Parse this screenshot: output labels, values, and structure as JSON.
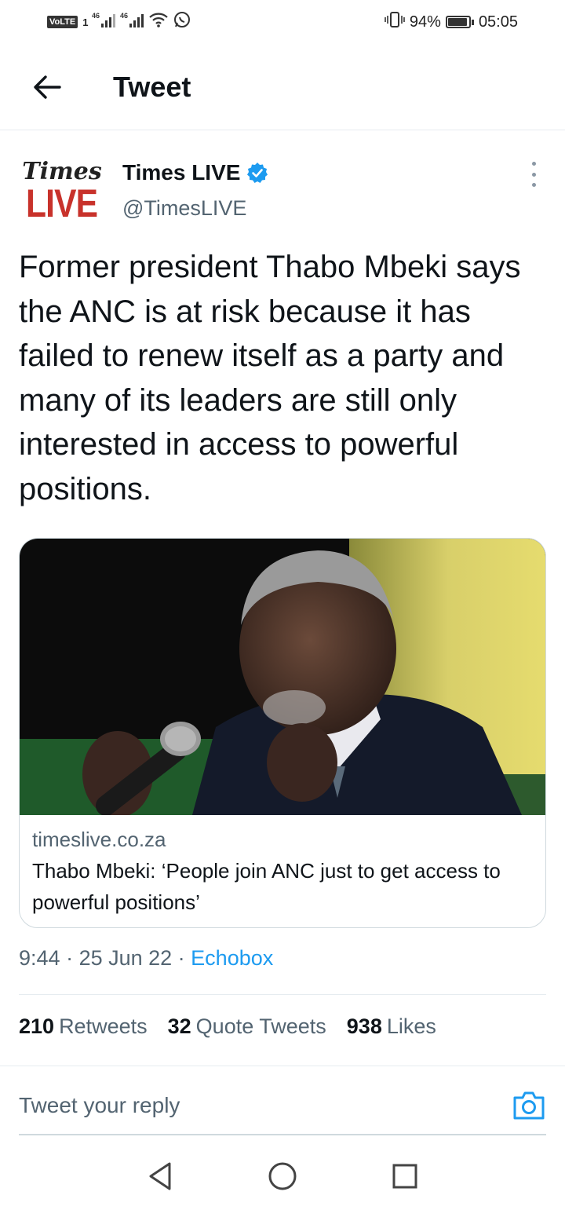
{
  "status_bar": {
    "volte": "VoLTE",
    "sim1": "1",
    "net1": "46",
    "net2": "46",
    "battery": "94%",
    "time": "05:05"
  },
  "header": {
    "title": "Tweet"
  },
  "author": {
    "logo_top": "Times",
    "logo_bottom": "LIVE",
    "name": "Times LIVE",
    "handle": "@TimesLIVE",
    "verified": true
  },
  "tweet": {
    "text": "Former president Thabo Mbeki says the ANC is at risk because it has failed to renew itself as a party and many of its leaders are still only interested in access to powerful positions."
  },
  "card": {
    "domain": "timeslive.co.za",
    "title": "Thabo Mbeki: ‘People join ANC just to get access to powerful positions’"
  },
  "meta": {
    "time": "9:44",
    "sep1": " · ",
    "date": "25 Jun 22",
    "sep2": " · ",
    "source": "Echobox"
  },
  "stats": {
    "retweets_count": "210",
    "retweets_label": "Retweets",
    "quotes_count": "32",
    "quotes_label": "Quote Tweets",
    "likes_count": "938",
    "likes_label": "Likes"
  },
  "reply": {
    "placeholder": "Tweet your reply"
  },
  "colors": {
    "accent": "#1d9bf0",
    "logo_red": "#c8322b",
    "muted": "#536471"
  }
}
